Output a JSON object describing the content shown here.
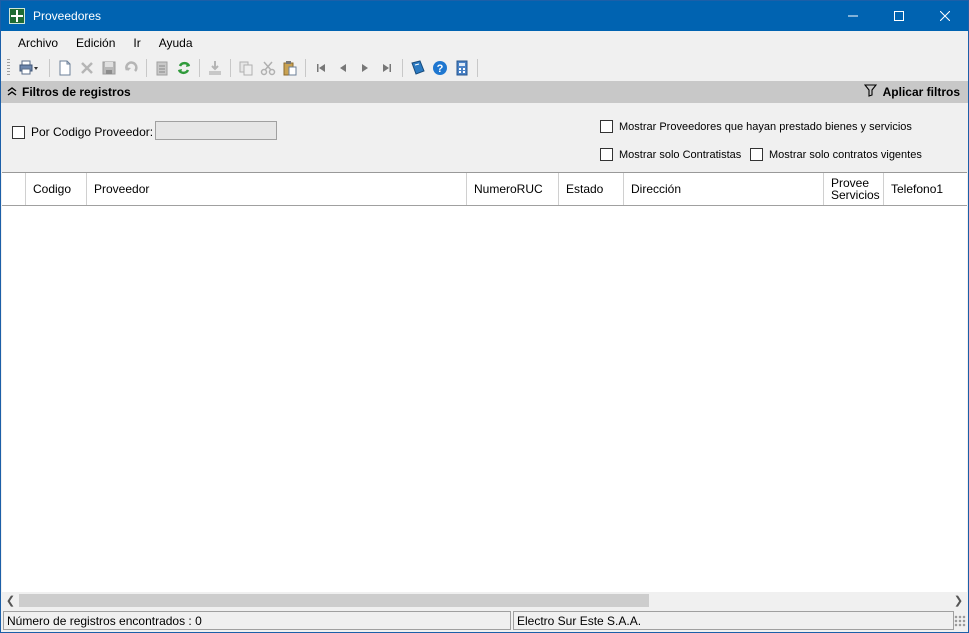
{
  "window": {
    "title": "Proveedores"
  },
  "menu": [
    "Archivo",
    "Edición",
    "Ir",
    "Ayuda"
  ],
  "toolbar_icons": [
    "print-icon",
    "new-document-icon",
    "delete-icon",
    "save-icon",
    "undo-icon",
    "clipboard-icon",
    "refresh-icon",
    "import-icon",
    "copy-icon",
    "cut-icon",
    "paste-icon",
    "first-record-icon",
    "previous-record-icon",
    "next-record-icon",
    "last-record-icon",
    "book-icon",
    "help-icon",
    "calculator-icon"
  ],
  "filter": {
    "header": "Filtros de registros",
    "apply_label": "Aplicar filtros",
    "by_code_label": "Por Codigo Proveedor:",
    "by_code_value": "",
    "show_goods_services": "Mostrar Proveedores  que hayan prestado bienes y servicios",
    "show_contractors": "Mostrar solo Contratistas",
    "show_active_contracts": "Mostrar solo contratos vigentes"
  },
  "grid": {
    "columns": [
      "Codigo",
      "Proveedor",
      "NumeroRUC",
      "Estado",
      "Dirección",
      "Provee\nServicios",
      "Telefono1"
    ],
    "rows": []
  },
  "status": {
    "records": "Número de registros encontrados : 0",
    "company": "Electro Sur Este S.A.A."
  }
}
